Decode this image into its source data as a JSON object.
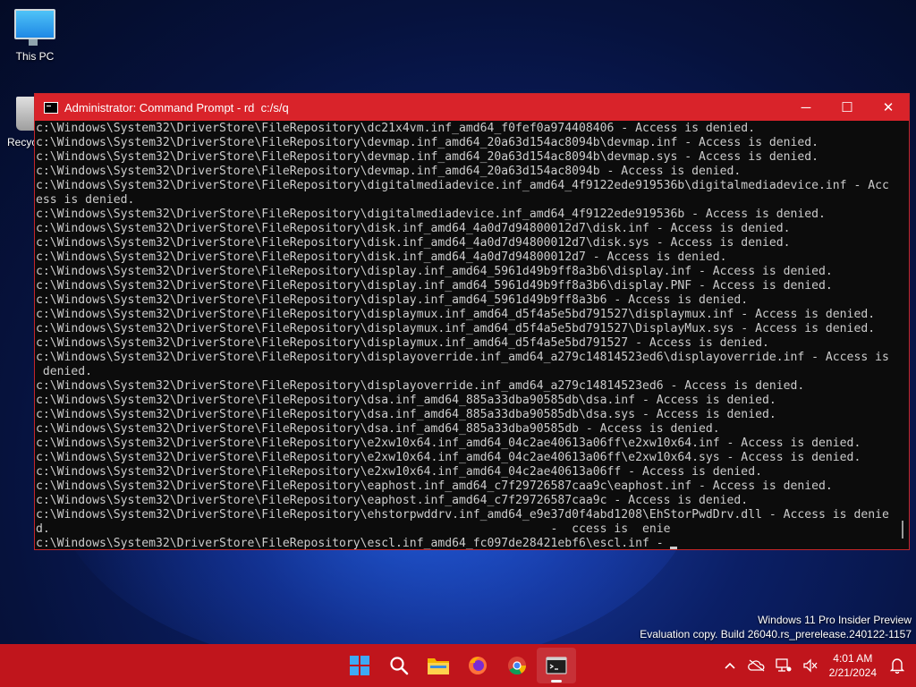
{
  "desktop": {
    "icons": [
      {
        "label": "This PC"
      },
      {
        "label": "Recyc"
      }
    ]
  },
  "window": {
    "title": "Administrator: Command Prompt - rd  c:/s/q",
    "buttons": {
      "minimize": "─",
      "maximize": "☐",
      "close": "✕"
    },
    "console_lines": [
      "c:\\Windows\\System32\\DriverStore\\FileRepository\\dc21x4vm.inf_amd64_f0fef0a974408406 - Access is denied.",
      "c:\\Windows\\System32\\DriverStore\\FileRepository\\devmap.inf_amd64_20a63d154ac8094b\\devmap.inf - Access is denied.",
      "c:\\Windows\\System32\\DriverStore\\FileRepository\\devmap.inf_amd64_20a63d154ac8094b\\devmap.sys - Access is denied.",
      "c:\\Windows\\System32\\DriverStore\\FileRepository\\devmap.inf_amd64_20a63d154ac8094b - Access is denied.",
      "c:\\Windows\\System32\\DriverStore\\FileRepository\\digitalmediadevice.inf_amd64_4f9122ede919536b\\digitalmediadevice.inf - Acc",
      "ess is denied.",
      "c:\\Windows\\System32\\DriverStore\\FileRepository\\digitalmediadevice.inf_amd64_4f9122ede919536b - Access is denied.",
      "c:\\Windows\\System32\\DriverStore\\FileRepository\\disk.inf_amd64_4a0d7d94800012d7\\disk.inf - Access is denied.",
      "c:\\Windows\\System32\\DriverStore\\FileRepository\\disk.inf_amd64_4a0d7d94800012d7\\disk.sys - Access is denied.",
      "c:\\Windows\\System32\\DriverStore\\FileRepository\\disk.inf_amd64_4a0d7d94800012d7 - Access is denied.",
      "c:\\Windows\\System32\\DriverStore\\FileRepository\\display.inf_amd64_5961d49b9ff8a3b6\\display.inf - Access is denied.",
      "c:\\Windows\\System32\\DriverStore\\FileRepository\\display.inf_amd64_5961d49b9ff8a3b6\\display.PNF - Access is denied.",
      "c:\\Windows\\System32\\DriverStore\\FileRepository\\display.inf_amd64_5961d49b9ff8a3b6 - Access is denied.",
      "c:\\Windows\\System32\\DriverStore\\FileRepository\\displaymux.inf_amd64_d5f4a5e5bd791527\\displaymux.inf - Access is denied.",
      "c:\\Windows\\System32\\DriverStore\\FileRepository\\displaymux.inf_amd64_d5f4a5e5bd791527\\DisplayMux.sys - Access is denied.",
      "c:\\Windows\\System32\\DriverStore\\FileRepository\\displaymux.inf_amd64_d5f4a5e5bd791527 - Access is denied.",
      "c:\\Windows\\System32\\DriverStore\\FileRepository\\displayoverride.inf_amd64_a279c14814523ed6\\displayoverride.inf - Access is",
      " denied.",
      "c:\\Windows\\System32\\DriverStore\\FileRepository\\displayoverride.inf_amd64_a279c14814523ed6 - Access is denied.",
      "c:\\Windows\\System32\\DriverStore\\FileRepository\\dsa.inf_amd64_885a33dba90585db\\dsa.inf - Access is denied.",
      "c:\\Windows\\System32\\DriverStore\\FileRepository\\dsa.inf_amd64_885a33dba90585db\\dsa.sys - Access is denied.",
      "c:\\Windows\\System32\\DriverStore\\FileRepository\\dsa.inf_amd64_885a33dba90585db - Access is denied.",
      "c:\\Windows\\System32\\DriverStore\\FileRepository\\e2xw10x64.inf_amd64_04c2ae40613a06ff\\e2xw10x64.inf - Access is denied.",
      "c:\\Windows\\System32\\DriverStore\\FileRepository\\e2xw10x64.inf_amd64_04c2ae40613a06ff\\e2xw10x64.sys - Access is denied.",
      "c:\\Windows\\System32\\DriverStore\\FileRepository\\e2xw10x64.inf_amd64_04c2ae40613a06ff - Access is denied.",
      "c:\\Windows\\System32\\DriverStore\\FileRepository\\eaphost.inf_amd64_c7f29726587caa9c\\eaphost.inf - Access is denied.",
      "c:\\Windows\\System32\\DriverStore\\FileRepository\\eaphost.inf_amd64_c7f29726587caa9c - Access is denied.",
      "c:\\Windows\\System32\\DriverStore\\FileRepository\\ehstorpwddrv.inf_amd64_e9e37d0f4abd1208\\EhStorPwdDrv.dll - Access is denie",
      "d.                                                                       -  ccess is  enie",
      "c:\\Windows\\System32\\DriverStore\\FileRepository\\escl.inf_amd64_fc097de28421ebf6\\escl.inf - "
    ]
  },
  "watermark": {
    "line1": "Windows 11 Pro Insider Preview",
    "line2": "Evaluation copy. Build 26040.rs_prerelease.240122-1157"
  },
  "taskbar": {
    "apps": [
      "start-icon",
      "search-icon",
      "file-explorer-icon",
      "firefox-icon",
      "chrome-icon",
      "terminal-icon"
    ],
    "time": "4:01 AM",
    "date": "2/21/2024"
  },
  "colors": {
    "taskbar": "#c0151c",
    "titlebar": "#d9232a",
    "console_bg": "#0c0c0c",
    "console_text": "#cccccc"
  }
}
